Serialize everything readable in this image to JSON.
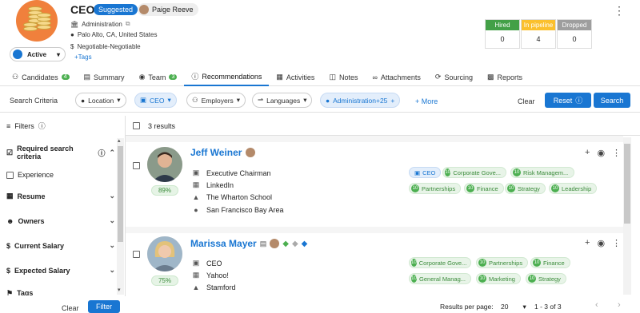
{
  "header": {
    "title": "CEO",
    "status_badge": "Suggested",
    "owner_name": "Paige Reeve",
    "department": "Administration",
    "location": "Palo Alto, CA, United States",
    "salary": "Negotiable-Negotiable",
    "tags_link": "+Tags",
    "state_label": "Active"
  },
  "stats": [
    {
      "label": "Hired",
      "value": "0",
      "color": "#43a047"
    },
    {
      "label": "In pipeline",
      "value": "4",
      "color": "#fbc02d"
    },
    {
      "label": "Dropped",
      "value": "0",
      "color": "#9e9e9e"
    }
  ],
  "tabs": [
    {
      "label": "Candidates",
      "count": "4"
    },
    {
      "label": "Summary"
    },
    {
      "label": "Team",
      "count": "3"
    },
    {
      "label": "Recommendations"
    },
    {
      "label": "Activities"
    },
    {
      "label": "Notes"
    },
    {
      "label": "Attachments"
    },
    {
      "label": "Sourcing"
    },
    {
      "label": "Reports"
    }
  ],
  "criteria": {
    "label": "Search Criteria",
    "location": "Location",
    "title_chip": "CEO",
    "employers": "Employers",
    "languages": "Languages",
    "admin_chip": "Administration+25",
    "more": "+ More",
    "clear": "Clear",
    "reset": "Reset",
    "search": "Search"
  },
  "filters": {
    "heading": "Filters",
    "required": "Required search criteria",
    "experience": "Experience",
    "sections": [
      "Resume",
      "Owners",
      "Current Salary",
      "Expected Salary",
      "Tags"
    ],
    "clear": "Clear",
    "filter": "Filter"
  },
  "results": {
    "count_text": "3 results",
    "candidates": [
      {
        "name": "Jeff Weiner",
        "score": "89%",
        "title": "Executive Chairman",
        "company": "LinkedIn",
        "school": "The Wharton School",
        "location": "San Francisco Bay Area",
        "chips_row1": [
          {
            "num": "",
            "text": "CEO",
            "kind": "blue"
          },
          {
            "num": "10",
            "text": "Corporate Gove..."
          },
          {
            "num": "10",
            "text": "Risk Managem..."
          }
        ],
        "chips_row2": [
          {
            "num": "10",
            "text": "Partnerships"
          },
          {
            "num": "10",
            "text": "Finance"
          },
          {
            "num": "10",
            "text": "Strategy"
          },
          {
            "num": "10",
            "text": "Leadership"
          }
        ]
      },
      {
        "name": "Marissa Mayer",
        "score": "75%",
        "title": "CEO",
        "company": "Yahoo!",
        "school": "Stamford",
        "chips_row1": [
          {
            "num": "10",
            "text": "Corporate Gove..."
          },
          {
            "num": "10",
            "text": "Partnerships"
          },
          {
            "num": "10",
            "text": "Finance"
          }
        ],
        "chips_row2": [
          {
            "num": "10",
            "text": "General Manag..."
          },
          {
            "num": "10",
            "text": "Marketing"
          },
          {
            "num": "10",
            "text": "Strategy"
          }
        ]
      }
    ]
  },
  "footer": {
    "rpp_label": "Results per page:",
    "rpp_value": "20",
    "range": "1 - 3 of 3"
  }
}
